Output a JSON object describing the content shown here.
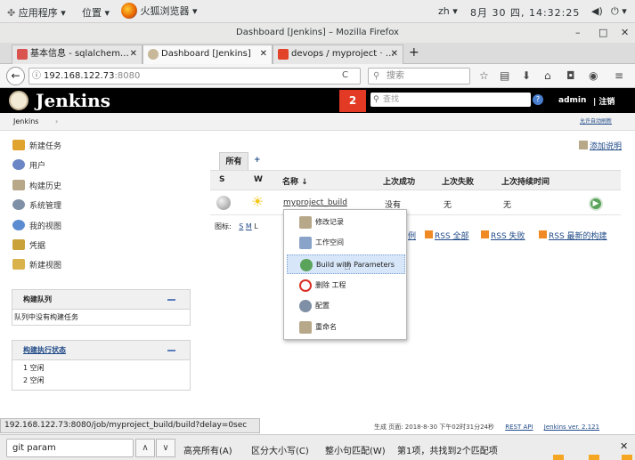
{
  "gnome": {
    "apps": "应用程序",
    "places": "位置",
    "browser": "火狐浏览器",
    "input": "zh",
    "clock": "8月 30 四, 14:32:25"
  },
  "window": {
    "title": "Dashboard [Jenkins] – Mozilla Firefox"
  },
  "tabs": [
    {
      "label": "基本信息 - sqlalchem…",
      "active": false
    },
    {
      "label": "Dashboard [Jenkins]",
      "active": true
    },
    {
      "label": "devops / myproject · …",
      "active": false
    }
  ],
  "navbar": {
    "url_host": "192.168.122.73",
    "url_port": ":8080",
    "search_placeholder": "搜索"
  },
  "jenkins": {
    "logo": "Jenkins",
    "notifications": "2",
    "search_placeholder": "查找",
    "user": "admin",
    "logout": "| 注销",
    "breadcrumb": "Jenkins",
    "auto_refresh": "允许自动刷新",
    "add_description": "添加说明"
  },
  "sidebar": {
    "items": [
      {
        "label": "新建任务",
        "icon": "folder-new-icon",
        "color": "#e0a32e"
      },
      {
        "label": "用户",
        "icon": "users-icon",
        "color": "#6a86c4"
      },
      {
        "label": "构建历史",
        "icon": "notepad-icon",
        "color": "#b8a88a"
      },
      {
        "label": "系统管理",
        "icon": "gear-icon",
        "color": "#7f8fa6"
      },
      {
        "label": "我的视图",
        "icon": "user-view-icon",
        "color": "#5b8bd0"
      },
      {
        "label": "凭据",
        "icon": "keys-icon",
        "color": "#c9a33a"
      },
      {
        "label": "新建视图",
        "icon": "folder-icon",
        "color": "#d9b24c"
      }
    ],
    "queue": {
      "title": "构建队列",
      "empty": "队列中没有构建任务"
    },
    "executors": {
      "title": "构建执行状态",
      "rows": [
        "1  空闲",
        "2  空闲"
      ]
    }
  },
  "main": {
    "view_tab": "所有",
    "add_tab": "+",
    "columns": [
      "S",
      "W",
      "名称 ↓",
      "上次成功",
      "上次失败",
      "上次持续时间"
    ],
    "job": {
      "name": "myproject_build",
      "last_success": "没有",
      "last_failure": "无",
      "duration": "无"
    },
    "legend_prefix": "图标:",
    "legend_sizes": [
      "S",
      "M",
      "L"
    ],
    "rss": [
      "例",
      "RSS 全部",
      "RSS 失败",
      "RSS 最新的构建"
    ]
  },
  "context_menu": {
    "items": [
      {
        "label": "修改记录",
        "icon": "notepad-icon",
        "color": "#b8a88a"
      },
      {
        "label": "工作空间",
        "icon": "folder-icon",
        "color": "#8aa4c9"
      },
      {
        "label": "Build with Parameters",
        "icon": "build-clock-icon",
        "color": "#5aa35a",
        "highlighted": true
      },
      {
        "label": "删除 工程",
        "icon": "delete-icon",
        "color": "#d93025"
      },
      {
        "label": "配置",
        "icon": "gear-icon",
        "color": "#7f8fa6"
      },
      {
        "label": "重命名",
        "icon": "notepad-icon",
        "color": "#b8a88a"
      }
    ]
  },
  "status_url": "192.168.122.73:8080/job/myproject_build/build?delay=0sec",
  "footer": {
    "generated": "生成 页面: 2018-8-30 下午02时31分24秒",
    "rest": "REST API",
    "version": "Jenkins ver. 2.121"
  },
  "findbar": {
    "query": "git param",
    "highlight_all": "高亮所有(A)",
    "match_case": "区分大小写(C)",
    "whole_words": "整小句匹配(W)",
    "result": "第1项，共找到2个匹配项"
  }
}
